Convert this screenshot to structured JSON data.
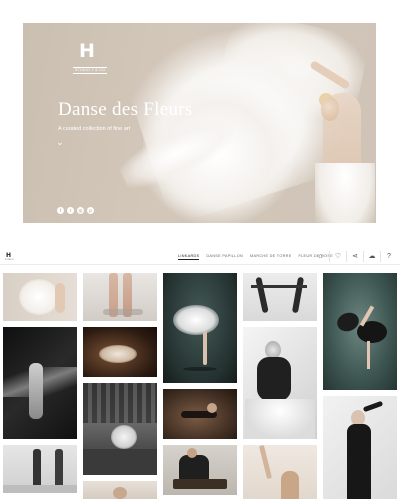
{
  "hero": {
    "logo_letter": "H",
    "logo_sub": "STUDIO T & CO",
    "title": "Danse des Fleurs",
    "subtitle": "A curated collection of fine art",
    "chevron": "⌄",
    "social": [
      "f",
      "t",
      "◎",
      "p"
    ]
  },
  "nav": {
    "logo_letter": "H",
    "logo_sub": "STUDIO",
    "links": [
      {
        "label": "LINKARDS",
        "active": true
      },
      {
        "label": "DANSE PAPILLON",
        "active": false
      },
      {
        "label": "MARCHE DE TORRE",
        "active": false
      },
      {
        "label": "FLEUR DE ROSE",
        "active": false
      }
    ],
    "icons": [
      "home-icon",
      "heart-icon",
      "share-icon",
      "cloud-download-icon",
      "help-icon"
    ],
    "icon_glyphs": [
      "⌂",
      "♡",
      "⋖",
      "☁",
      "?"
    ]
  },
  "gallery": {
    "photos": [
      {
        "name": "photo-white-fabric"
      },
      {
        "name": "photo-pointe-shoes"
      },
      {
        "name": "photo-dancer-white-flow"
      },
      {
        "name": "photo-dancer-pair"
      },
      {
        "name": "photo-dancer-leap-teal"
      },
      {
        "name": "photo-dancer-motion-blur"
      },
      {
        "name": "photo-dancer-floor-warm"
      },
      {
        "name": "photo-dancer-sitting-bw"
      },
      {
        "name": "photo-dancer-forest-bw"
      },
      {
        "name": "photo-dancer-floor-brown"
      },
      {
        "name": "photo-dancer-black-outfit"
      },
      {
        "name": "photo-pointe-shoes-bw"
      },
      {
        "name": "photo-dancer-bench"
      },
      {
        "name": "photo-dancer-arms-up"
      },
      {
        "name": "photo-partial-bottom"
      }
    ]
  }
}
